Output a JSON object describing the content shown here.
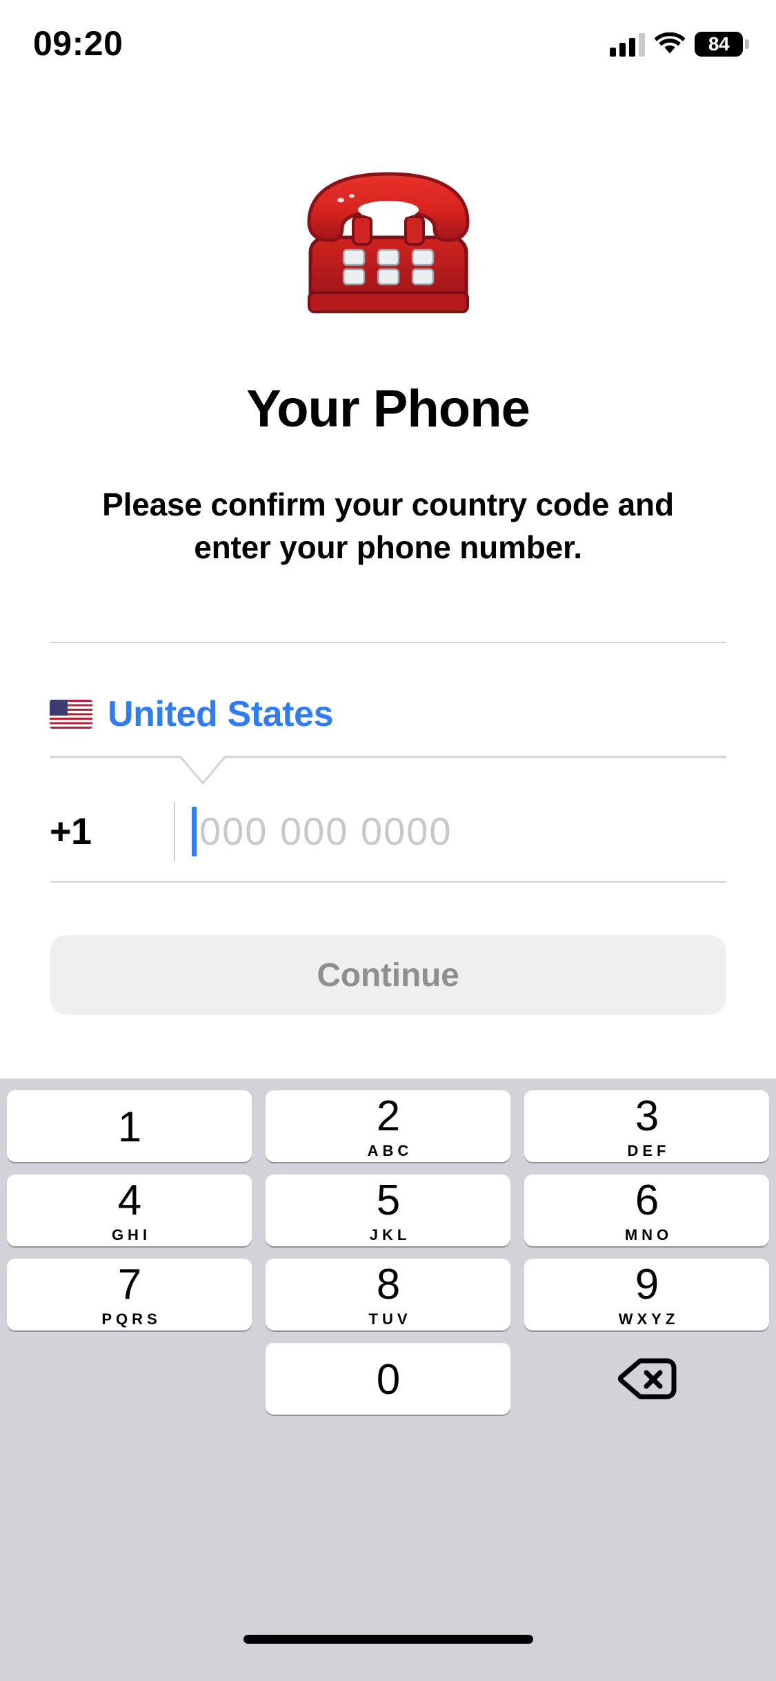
{
  "status_bar": {
    "time": "09:20",
    "battery_level": "84",
    "cellular_icon": "signal-bars-icon",
    "wifi_icon": "wifi-icon",
    "battery_icon": "battery-icon"
  },
  "hero": {
    "emoji": "☎️",
    "icon_name": "telephone-emoji"
  },
  "page": {
    "title": "Your Phone",
    "subtitle": "Please confirm your country code and enter your phone number."
  },
  "country_selector": {
    "flag_emoji": "🇺🇸",
    "country_name": "United States",
    "accent_color": "#2f7cf6",
    "chevron_icon": "chevron-down-icon"
  },
  "phone_input": {
    "dial_code": "+1",
    "value": "",
    "placeholder": "000 000 0000",
    "caret_color": "#2f7cf6"
  },
  "primary_action": {
    "label": "Continue",
    "disabled": true,
    "background": "#efeff0",
    "text_color": "#8e8e93"
  },
  "keypad": {
    "background": "#d1d3d9",
    "rows": [
      [
        {
          "digit": "1",
          "letters": ""
        },
        {
          "digit": "2",
          "letters": "ABC"
        },
        {
          "digit": "3",
          "letters": "DEF"
        }
      ],
      [
        {
          "digit": "4",
          "letters": "GHI"
        },
        {
          "digit": "5",
          "letters": "JKL"
        },
        {
          "digit": "6",
          "letters": "MNO"
        }
      ],
      [
        {
          "digit": "7",
          "letters": "PQRS"
        },
        {
          "digit": "8",
          "letters": "TUV"
        },
        {
          "digit": "9",
          "letters": "WXYZ"
        }
      ],
      [
        {
          "digit": "",
          "letters": ""
        },
        {
          "digit": "0",
          "letters": ""
        },
        {
          "digit": "",
          "letters": "",
          "icon": "backspace-icon"
        }
      ]
    ]
  },
  "home_indicator": {
    "present": true
  }
}
